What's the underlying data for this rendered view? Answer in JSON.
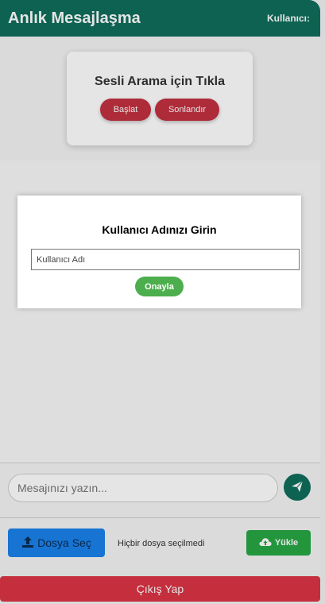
{
  "header": {
    "title": "Anlık Mesajlaşma",
    "user_label": "Kullanıcı:"
  },
  "call": {
    "title": "Sesli Arama için Tıkla",
    "start_label": "Başlat",
    "end_label": "Sonlandır"
  },
  "composer": {
    "placeholder": "Mesajınızı yazın..."
  },
  "file": {
    "choose_label": "Dosya Seç",
    "status": "Hiçbir dosya seçilmedi",
    "upload_label": "Yükle"
  },
  "logout_label": "Çıkış Yap",
  "modal": {
    "title": "Kullanıcı Adınızı Girin",
    "input_placeholder": "Kullanıcı Adı",
    "confirm_label": "Onayla"
  },
  "colors": {
    "header": "#0f6e5c",
    "danger": "#dc3545",
    "success": "#28a745",
    "primary": "#1a82ea"
  }
}
